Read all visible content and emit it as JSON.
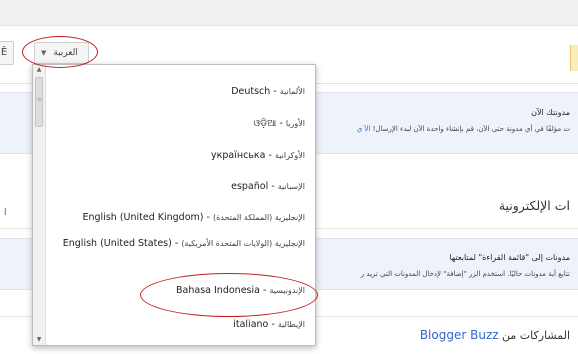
{
  "language_select": {
    "selected": "العربية"
  },
  "left_button": {
    "label": "Ê"
  },
  "panel_top": {
    "line1": "مدونتك الآن",
    "line2": "ت مؤلفًا في أي مدونة حتى الآن، قم بإنشاء واحدة الآن لبدء الإرسال!",
    "link": "الآ ي"
  },
  "section_heading": "ات الإلكترونية",
  "left_fragment": "ا",
  "panel_bottom": {
    "line1": "مدونات إلى \"قائمة القراءة\" لمتابعتها",
    "line2": "تتابع أية مدونات حاليًا. استخدم الزر \"إضافة\" لإدخال المدونات التي تريد ر"
  },
  "buzz_heading": {
    "prefix": "المشاركات من",
    "link": "Blogger Buzz"
  },
  "dropdown": {
    "options": [
      {
        "native": "Deutsch",
        "arabic": "الألمانية"
      },
      {
        "native": "ଓଡ଼ିଆ",
        "arabic": "الأوريا"
      },
      {
        "native": "українська",
        "arabic": "الأوكرانية"
      },
      {
        "native": "español",
        "arabic": "الإسبانية"
      },
      {
        "native": "English (United Kingdom)",
        "arabic": "الإنجليزية (المملكة المتحدة)"
      },
      {
        "native": "English (United States)",
        "arabic": "الإنجليزية (الولايات المتحدة الأمريكية)"
      },
      {
        "native": "Bahasa Indonesia",
        "arabic": "الإندونيسية"
      },
      {
        "native": "italiano",
        "arabic": "الإيطالية"
      }
    ]
  },
  "colors": {
    "annotation_red": "#c41e1e",
    "link_blue": "#3366cc",
    "panel_blue": "#eef3fb"
  },
  "icons": {
    "select_caret": "chevron-down-icon",
    "scroll_up": "arrow-up-icon",
    "scroll_down": "arrow-down-icon"
  }
}
